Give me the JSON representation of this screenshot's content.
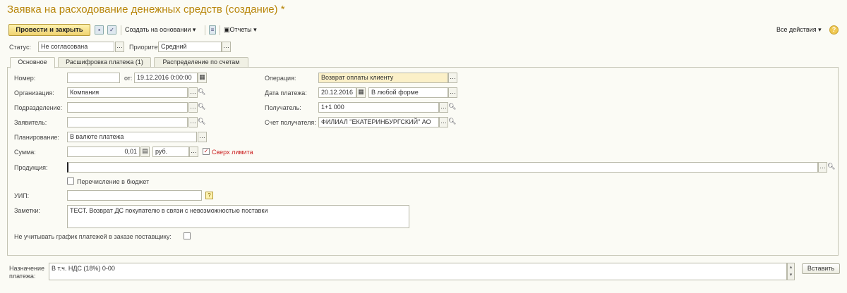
{
  "title": "Заявка на расходование денежных средств (создание) *",
  "toolbar": {
    "post_close": "Провести и закрыть",
    "create_based": "Создать на основании",
    "reports": "Отчеты",
    "all_actions": "Все действия",
    "help": "?"
  },
  "status": {
    "label": "Статус:",
    "value": "Не согласована"
  },
  "priority": {
    "label": "Приоритет:",
    "value": "Средний"
  },
  "tabs": [
    {
      "label": "Основное",
      "active": true
    },
    {
      "label": "Расшифровка платежа (1)",
      "active": false
    },
    {
      "label": "Распределение по счетам",
      "active": false
    }
  ],
  "form": {
    "number": {
      "label": "Номер:",
      "value": ""
    },
    "from": {
      "label": "от:",
      "value": "19.12.2016  0:00:00"
    },
    "organization": {
      "label": "Организация:",
      "value": "Компания"
    },
    "division": {
      "label": "Подразделение:",
      "value": ""
    },
    "applicant": {
      "label": "Заявитель:",
      "value": ""
    },
    "planning": {
      "label": "Планирование:",
      "value": "В валюте платежа"
    },
    "amount": {
      "label": "Сумма:",
      "value": "0,01",
      "currency": "руб.",
      "over_limit": "Сверх лимита",
      "over_limit_checked": true
    },
    "product": {
      "label": "Продукция:",
      "value": ""
    },
    "budget_transfer": {
      "label": "Перечисление в бюджет",
      "checked": false
    },
    "uip": {
      "label": "УИП:",
      "value": ""
    },
    "notes": {
      "label": "Заметки:",
      "value": "ТЕСТ. Возврат ДС покупателю в связи с невозможностью поставки"
    },
    "ignore_schedule": {
      "label": "Не учитывать график платежей в заказе поставщику:",
      "checked": false
    },
    "operation": {
      "label": "Операция:",
      "value": "Возврат оплаты клиенту"
    },
    "payment_date": {
      "label": "Дата платежа:",
      "value": "20.12.2016",
      "form": "В любой форме"
    },
    "recipient": {
      "label": "Получатель:",
      "value": "1+1 000"
    },
    "recipient_account": {
      "label": "Счет получателя:",
      "value": "ФИЛИАЛ \"ЕКАТЕРИНБУРГСКИЙ\" АО"
    }
  },
  "purpose": {
    "label_line1": "Назначение",
    "label_line2": "платежа:",
    "value": "В т.ч. НДС (18%) 0-00"
  },
  "insert_button": "Вставить",
  "colors": {
    "title": "#b8860b",
    "accent_button": "#f0d270",
    "operation_field": "#fbf0c8",
    "over_limit": "#cc2222"
  }
}
